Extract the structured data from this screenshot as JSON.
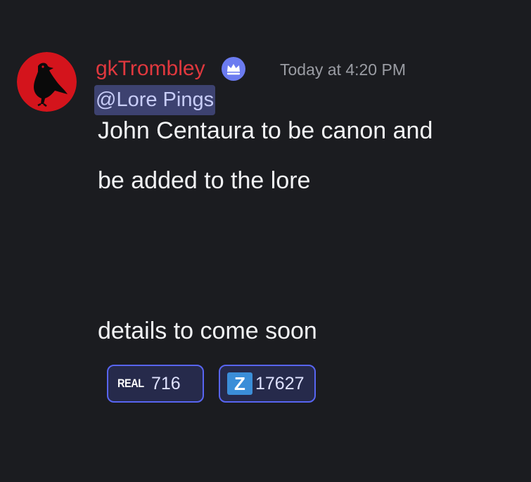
{
  "message": {
    "author": {
      "username": "gkTrombley",
      "username_color": "#e0383e",
      "avatar_icon": "raven-avatar-icon",
      "badge_icon": "crown-badge-icon"
    },
    "timestamp": "Today at 4:20 PM",
    "mention": "@Lore Pings",
    "lines": [
      "John Centaura to be canon and",
      "be added to the lore",
      "details to come soon"
    ],
    "reactions": [
      {
        "emoji_label": "REAL",
        "count": "716"
      },
      {
        "emoji_label": "Z",
        "count": "17627"
      }
    ]
  },
  "colors": {
    "background": "#1b1c20",
    "mention_bg": "#3d4270",
    "reaction_border": "#5865f2",
    "badge": "#6b7bf0"
  }
}
